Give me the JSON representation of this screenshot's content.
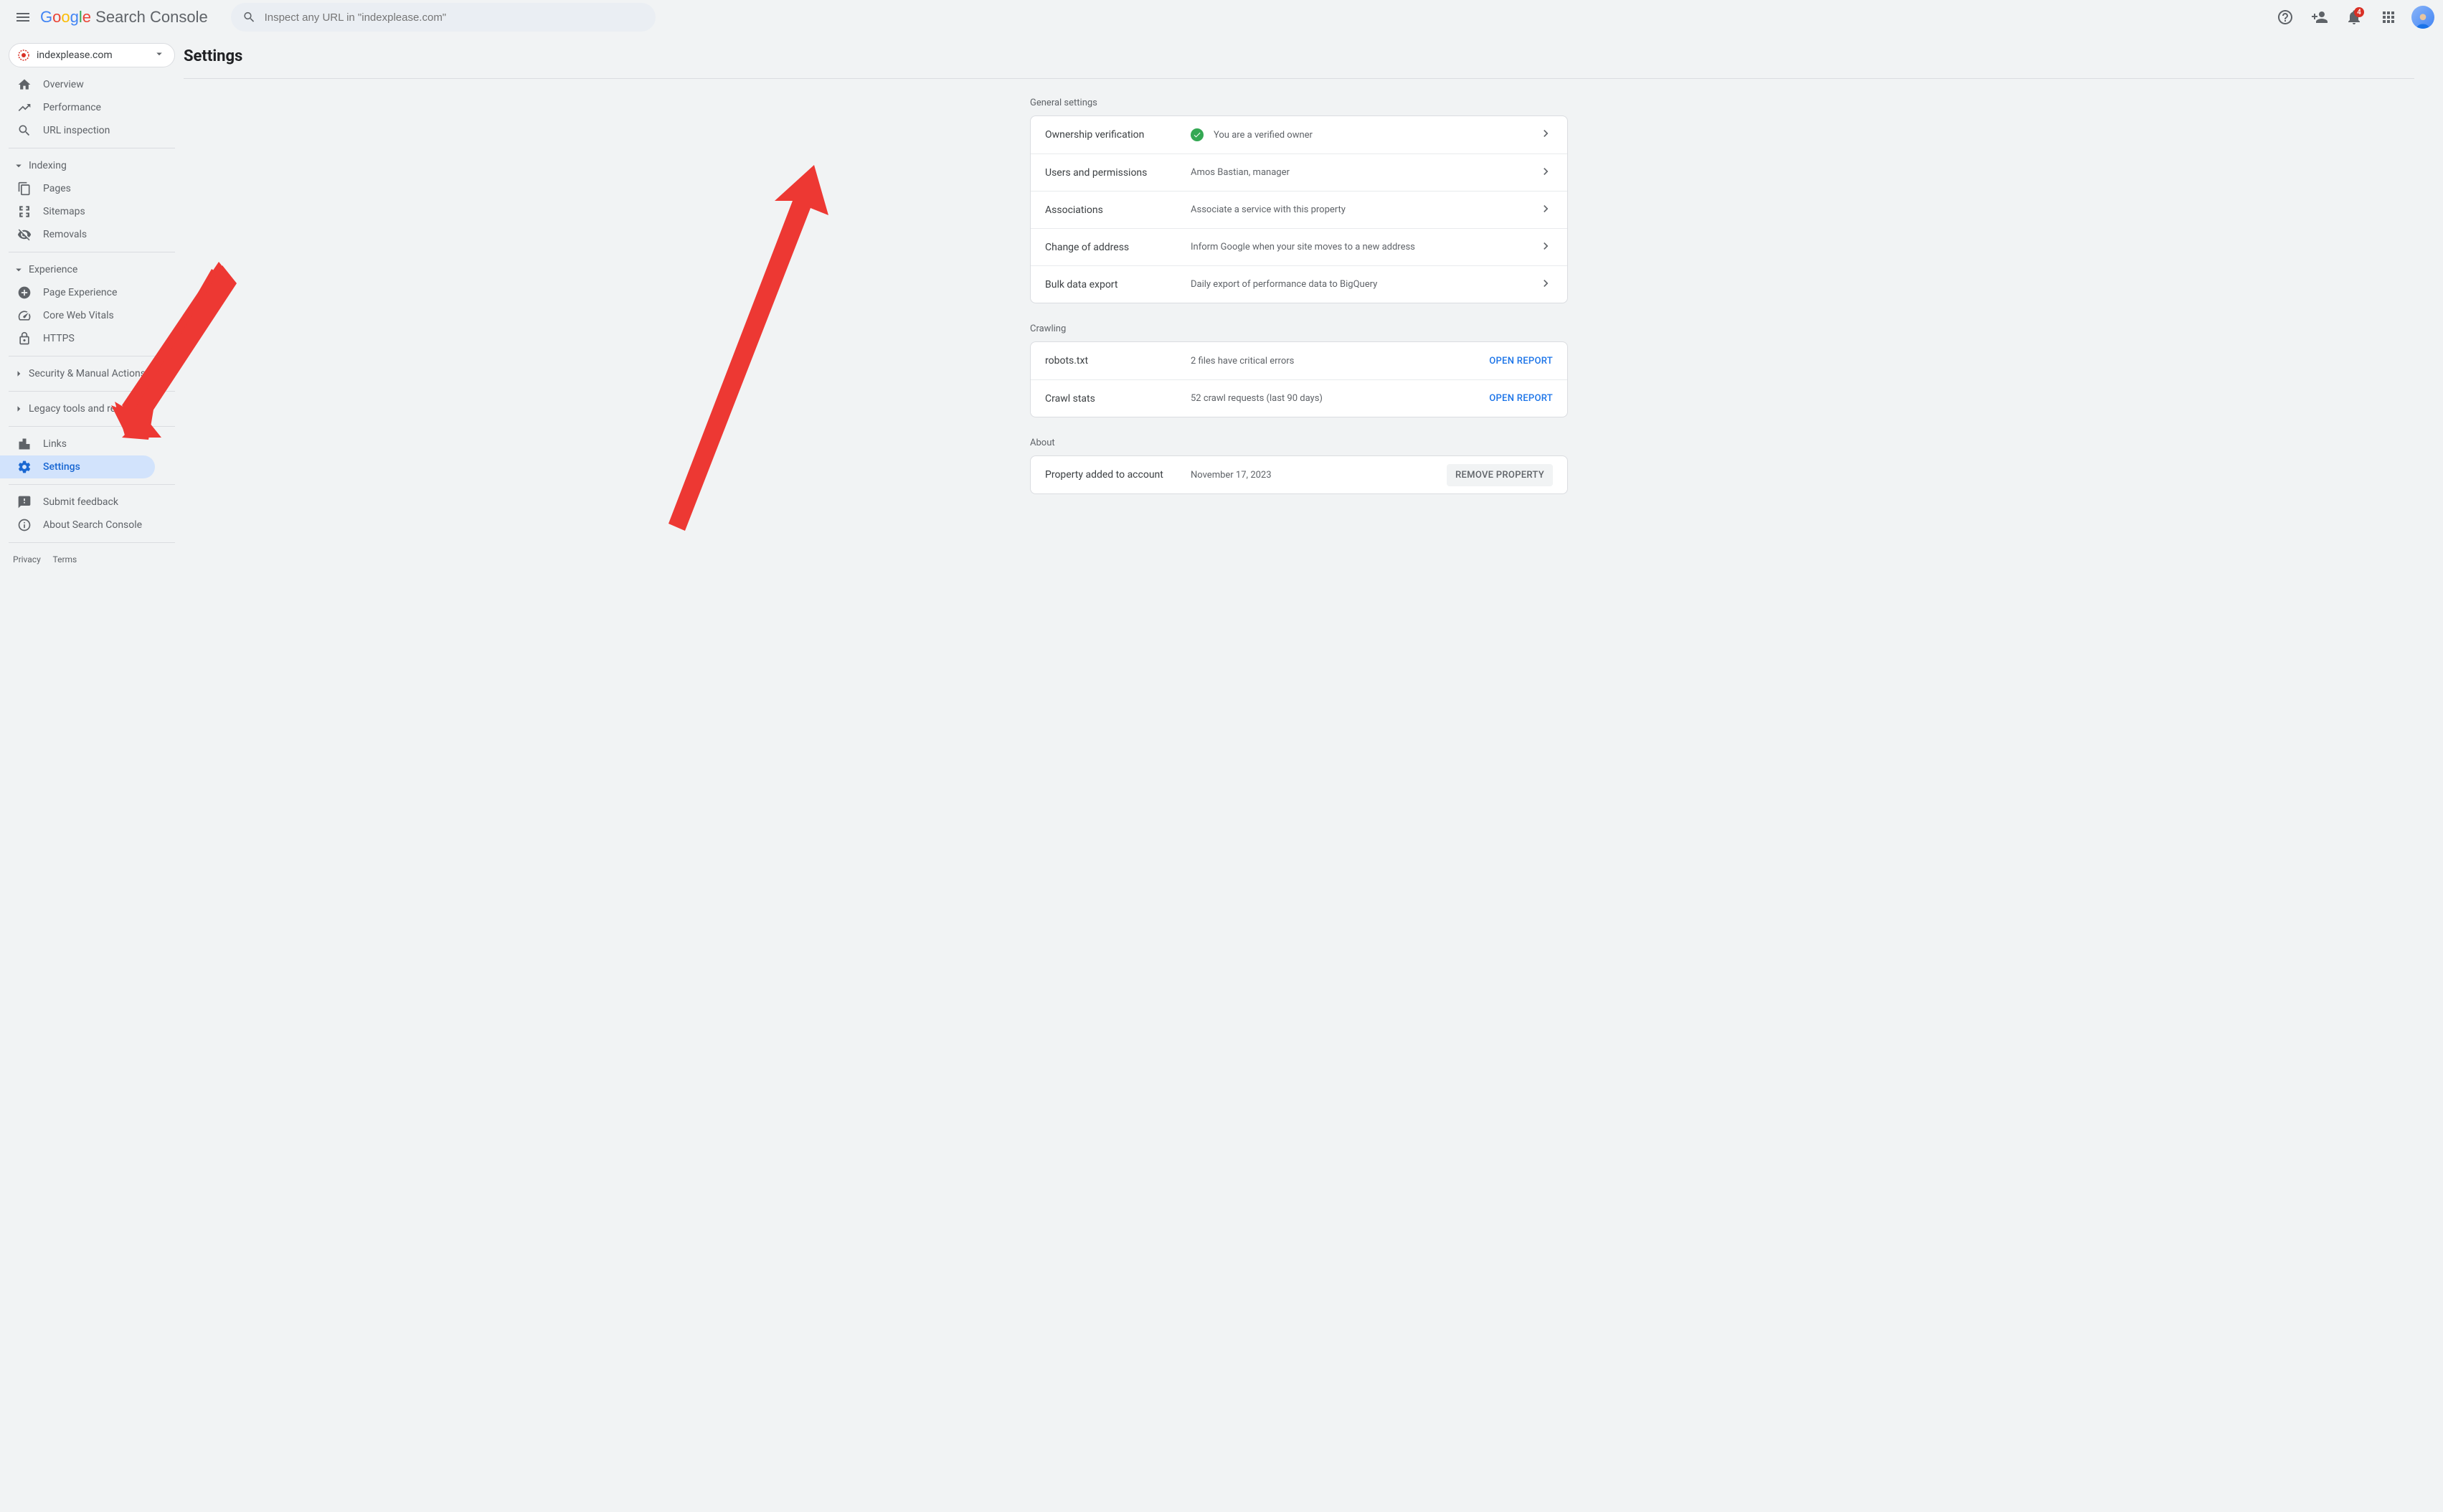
{
  "header": {
    "product_name": "Search Console",
    "search_placeholder": "Inspect any URL in \"indexplease.com\"",
    "notification_count": "4"
  },
  "property": {
    "domain": "indexplease.com"
  },
  "sidebar": {
    "overview": "Overview",
    "performance": "Performance",
    "url_inspection": "URL inspection",
    "indexing_section": "Indexing",
    "pages": "Pages",
    "sitemaps": "Sitemaps",
    "removals": "Removals",
    "experience_section": "Experience",
    "page_experience": "Page Experience",
    "core_web_vitals": "Core Web Vitals",
    "https": "HTTPS",
    "security_section": "Security & Manual Actions",
    "legacy_section": "Legacy tools and reports",
    "links": "Links",
    "settings": "Settings",
    "submit_feedback": "Submit feedback",
    "about_console": "About Search Console",
    "privacy": "Privacy",
    "terms": "Terms"
  },
  "page": {
    "title": "Settings",
    "general_settings": "General settings",
    "crawling": "Crawling",
    "about": "About"
  },
  "rows": {
    "ownership": {
      "label": "Ownership verification",
      "detail": "You are a verified owner"
    },
    "users": {
      "label": "Users and permissions",
      "detail": "Amos Bastian, manager"
    },
    "associations": {
      "label": "Associations",
      "detail": "Associate a service with this property"
    },
    "address": {
      "label": "Change of address",
      "detail": "Inform Google when your site moves to a new address"
    },
    "bulk": {
      "label": "Bulk data export",
      "detail": "Daily export of performance data to BigQuery"
    },
    "robots": {
      "label": "robots.txt",
      "detail": "2 files have critical errors",
      "action": "OPEN REPORT"
    },
    "crawl": {
      "label": "Crawl stats",
      "detail": "52 crawl requests (last 90 days)",
      "action": "OPEN REPORT"
    },
    "added": {
      "label": "Property added to account",
      "detail": "November 17, 2023",
      "action": "REMOVE PROPERTY"
    }
  }
}
